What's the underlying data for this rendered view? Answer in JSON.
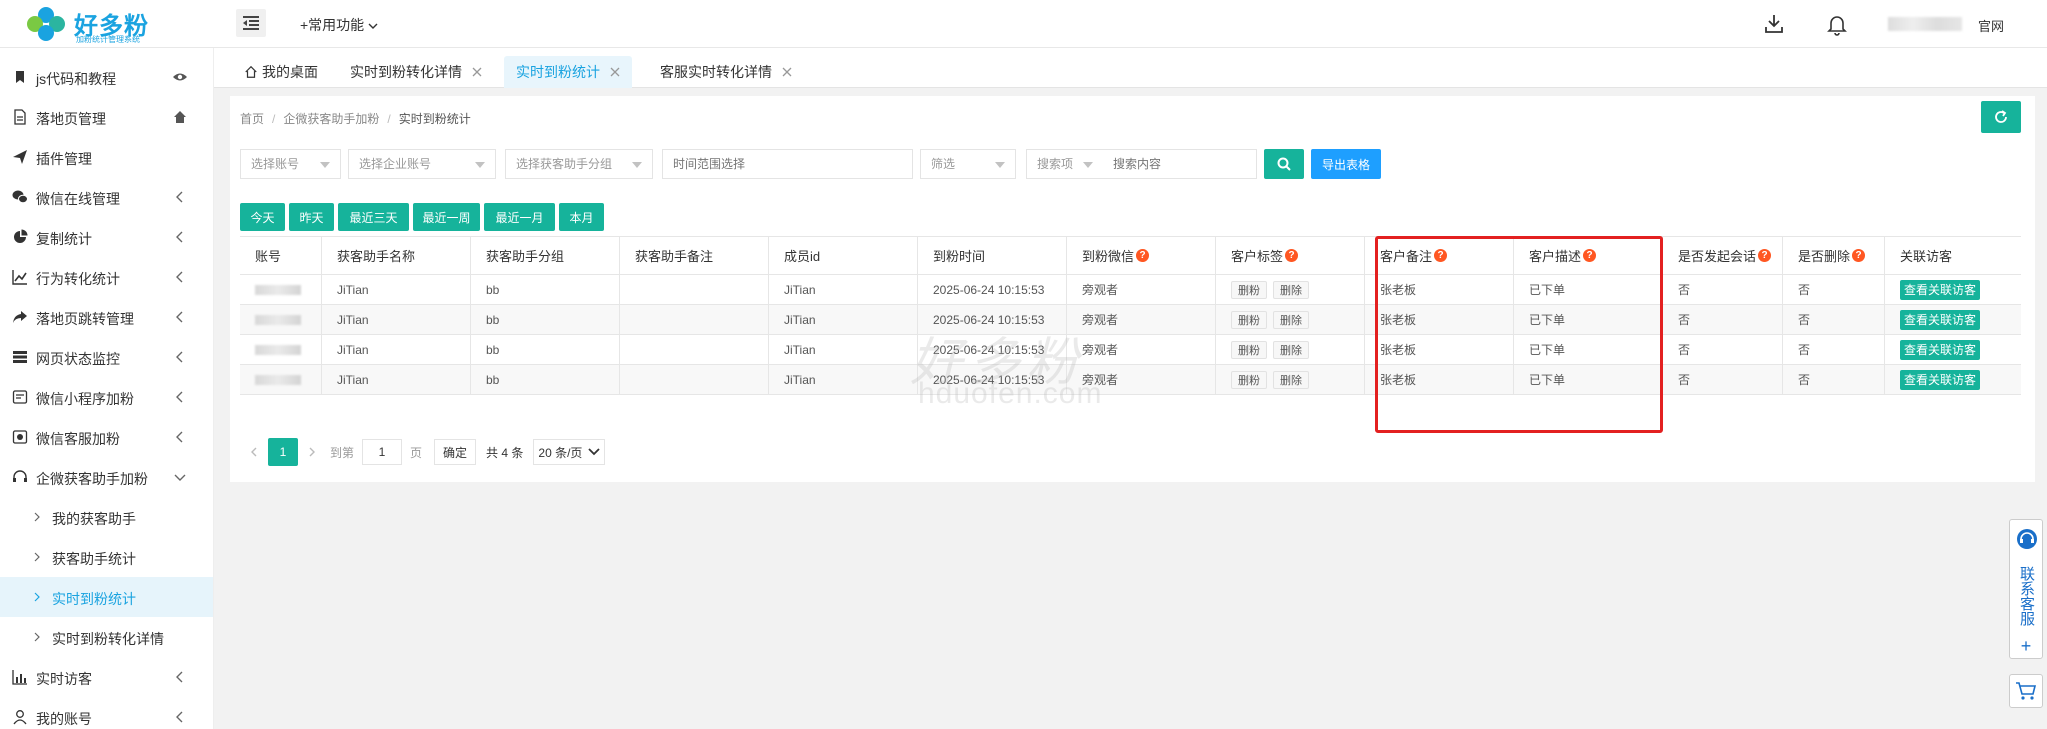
{
  "header": {
    "logo_title": "好多粉",
    "logo_subtitle": "加粉统计管理系统",
    "common_functions": "+常用功能",
    "official_site": "官网"
  },
  "sidebar": {
    "items": [
      {
        "label": "js代码和教程",
        "icon": "bookmark-icon",
        "trail": "eye-icon"
      },
      {
        "label": "落地页管理",
        "icon": "file-icon",
        "trail": "home-icon"
      },
      {
        "label": "插件管理",
        "icon": "send-icon",
        "trail": ""
      },
      {
        "label": "微信在线管理",
        "icon": "wechat-icon",
        "trail": "chevron-left-icon"
      },
      {
        "label": "复制统计",
        "icon": "pie-chart-icon",
        "trail": "chevron-left-icon"
      },
      {
        "label": "行为转化统计",
        "icon": "line-chart-icon",
        "trail": "chevron-left-icon"
      },
      {
        "label": "落地页跳转管理",
        "icon": "share-icon",
        "trail": "chevron-left-icon"
      },
      {
        "label": "网页状态监控",
        "icon": "server-icon",
        "trail": "chevron-left-icon"
      },
      {
        "label": "微信小程序加粉",
        "icon": "mini-program-icon",
        "trail": "chevron-left-icon"
      },
      {
        "label": "微信客服加粉",
        "icon": "customer-service-icon",
        "trail": "chevron-left-icon"
      },
      {
        "label": "企微获客助手加粉",
        "icon": "headset-icon",
        "trail": "chevron-down-icon"
      }
    ],
    "sub_items": [
      {
        "label": "我的获客助手"
      },
      {
        "label": "获客助手统计"
      },
      {
        "label": "实时到粉统计"
      },
      {
        "label": "实时到粉转化详情"
      }
    ],
    "bottom_items": [
      {
        "label": "实时访客",
        "icon": "bar-chart-icon"
      },
      {
        "label": "我的账号",
        "icon": "user-icon"
      }
    ]
  },
  "tabs": [
    {
      "label": "我的桌面"
    },
    {
      "label": "实时到粉转化详情"
    },
    {
      "label": "实时到粉统计"
    },
    {
      "label": "客服实时转化详情"
    }
  ],
  "breadcrumb": [
    "首页",
    "企微获客助手加粉",
    "实时到粉统计"
  ],
  "filters": {
    "account": "选择账号",
    "enterprise": "选择企业账号",
    "group": "选择获客助手分组",
    "time_range": "时间范围选择",
    "screen": "筛选",
    "search_field": "搜索项",
    "search_content": "搜索内容",
    "export": "导出表格"
  },
  "quick_ranges": [
    "今天",
    "昨天",
    "最近三天",
    "最近一周",
    "最近一月",
    "本月"
  ],
  "table": {
    "columns": [
      "账号",
      "获客助手名称",
      "获客助手分组",
      "获客助手备注",
      "成员id",
      "到粉时间",
      "到粉微信",
      "客户标签",
      "客户备注",
      "客户描述",
      "是否发起会话",
      "是否删除",
      "关联访客"
    ],
    "rows": [
      {
        "name": "JiTian",
        "group": "bb",
        "remark": "",
        "member": "JiTian",
        "time": "2025-06-24 10:15:53",
        "wechat": "旁观者",
        "tag1": "删粉",
        "tag2": "删除",
        "cust_remark": "张老板",
        "cust_desc": "已下单",
        "session": "否",
        "deleted": "否",
        "action": "查看关联访客"
      },
      {
        "name": "JiTian",
        "group": "bb",
        "remark": "",
        "member": "JiTian",
        "time": "2025-06-24 10:15:53",
        "wechat": "旁观者",
        "tag1": "删粉",
        "tag2": "删除",
        "cust_remark": "张老板",
        "cust_desc": "已下单",
        "session": "否",
        "deleted": "否",
        "action": "查看关联访客"
      },
      {
        "name": "JiTian",
        "group": "bb",
        "remark": "",
        "member": "JiTian",
        "time": "2025-06-24 10:15:53",
        "wechat": "旁观者",
        "tag1": "删粉",
        "tag2": "删除",
        "cust_remark": "张老板",
        "cust_desc": "已下单",
        "session": "否",
        "deleted": "否",
        "action": "查看关联访客"
      },
      {
        "name": "JiTian",
        "group": "bb",
        "remark": "",
        "member": "JiTian",
        "time": "2025-06-24 10:15:53",
        "wechat": "旁观者",
        "tag1": "删粉",
        "tag2": "删除",
        "cust_remark": "张老板",
        "cust_desc": "已下单",
        "session": "否",
        "deleted": "否",
        "action": "查看关联访客"
      }
    ]
  },
  "pagination": {
    "current": "1",
    "goto_label": "到第",
    "goto_value": "1",
    "page_label": "页",
    "confirm": "确定",
    "total": "共 4 条",
    "page_size": "20 条/页"
  },
  "watermark": {
    "cn": "好多粉",
    "en": "hduofen.com"
  },
  "float_service": {
    "label": "联系客服",
    "plus": "+"
  },
  "colors": {
    "brand": "#1aa3e0",
    "primary": "#16b39b",
    "export": "#1e9fff",
    "highlight_box": "#e32020",
    "help_icon": "#ff5722"
  }
}
